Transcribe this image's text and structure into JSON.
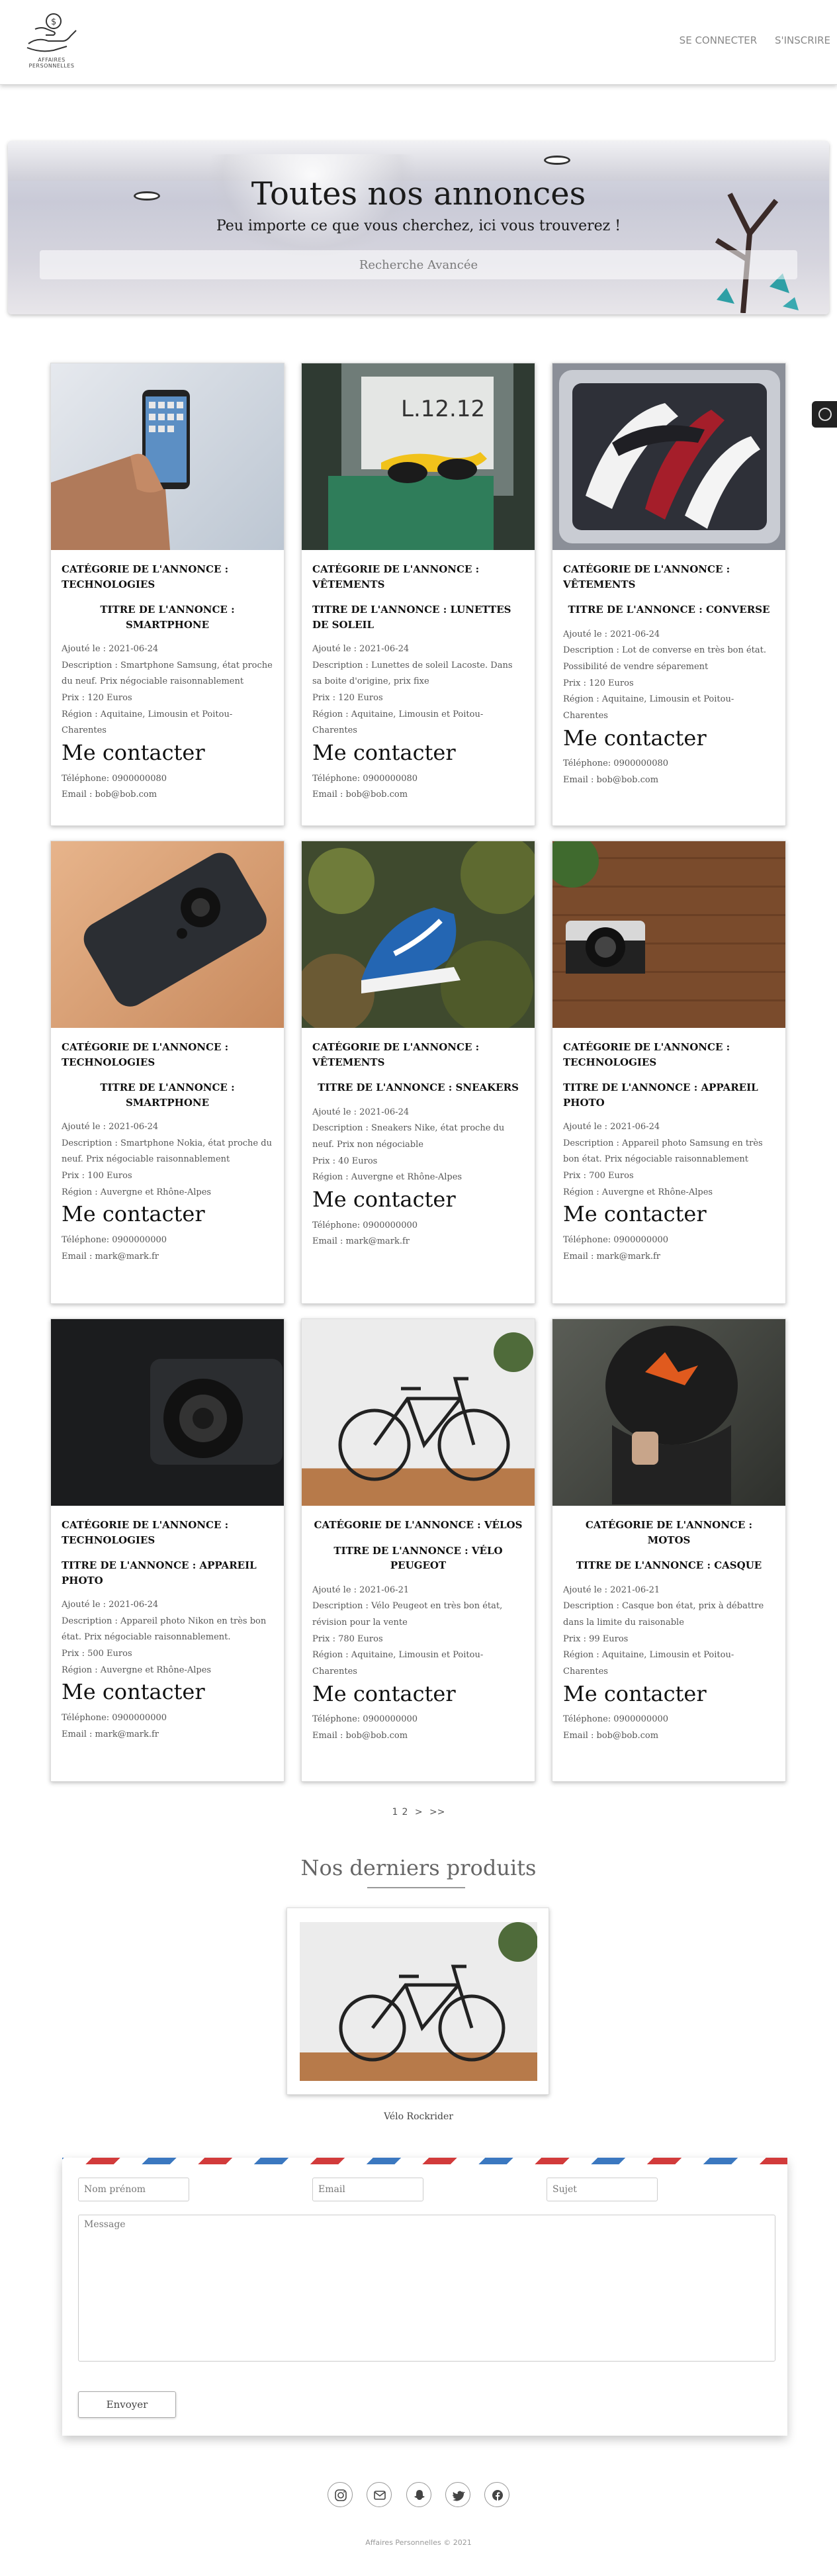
{
  "header": {
    "logo_text": "AFFAIRES PERSONNELLES",
    "nav": [
      {
        "label": "SE CONNECTER"
      },
      {
        "label": "S'INSCRIRE"
      }
    ]
  },
  "hero": {
    "title": "Toutes nos annonces",
    "subtitle": "Peu importe ce que vous cherchez, ici vous trouverez !",
    "search_placeholder": "Recherche Avancée"
  },
  "listings": [
    {
      "category": "CATÉGORIE DE L'ANNONCE : TECHNOLOGIES",
      "title": "TITRE DE L'ANNONCE : SMARTPHONE",
      "added": "Ajouté le : 2021-06-24",
      "description": "Description : Smartphone Samsung, état proche du neuf. Prix négociable raisonnablement",
      "price": "Prix : 120 Euros",
      "region": "Région : Aquitaine, Limousin et Poitou-Charentes",
      "contact": "Me contacter",
      "phone": "Téléphone: 0900000080",
      "email": "Email : bob@bob.com",
      "image": "phone-in-hand"
    },
    {
      "category": "CATÉGORIE DE L'ANNONCE : VÊTEMENTS",
      "title": "TITRE DE L'ANNONCE : LUNETTES DE SOLEIL",
      "added": "Ajouté le : 2021-06-24",
      "description": "Description : Lunettes de soleil Lacoste. Dans sa boite d'origine, prix fixe",
      "price": "Prix : 120 Euros",
      "region": "Région : Aquitaine, Limousin et Poitou-Charentes",
      "contact": "Me contacter",
      "phone": "Téléphone: 0900000080",
      "email": "Email : bob@bob.com",
      "image": "sunglasses"
    },
    {
      "category": "CATÉGORIE DE L'ANNONCE : VÊTEMENTS",
      "title": "TITRE DE L'ANNONCE : CONVERSE",
      "added": "Ajouté le : 2021-06-24",
      "description": "Description : Lot de converse en très bon état. Possibilité de vendre séparement",
      "price": "Prix : 120 Euros",
      "region": "Région : Aquitaine, Limousin et Poitou-Charentes",
      "contact": "Me contacter",
      "phone": "Téléphone: 0900000080",
      "email": "Email : bob@bob.com",
      "image": "sneakers-basket"
    },
    {
      "category": "CATÉGORIE DE L'ANNONCE : TECHNOLOGIES",
      "title": "TITRE DE L'ANNONCE : SMARTPHONE",
      "added": "Ajouté le : 2021-06-24",
      "description": "Description : Smartphone Nokia, état proche du neuf. Prix négociable raisonnablement",
      "price": "Prix : 100 Euros",
      "region": "Région : Auvergne et Rhône-Alpes",
      "contact": "Me contacter",
      "phone": "Téléphone: 0900000000",
      "email": "Email : mark@mark.fr",
      "image": "nokia-phone"
    },
    {
      "category": "CATÉGORIE DE L'ANNONCE : VÊTEMENTS",
      "title": "TITRE DE L'ANNONCE : SNEAKERS",
      "added": "Ajouté le : 2021-06-24",
      "description": "Description : Sneakers Nike, état proche du neuf. Prix non négociable",
      "price": "Prix : 40 Euros",
      "region": "Région : Auvergne et Rhône-Alpes",
      "contact": "Me contacter",
      "phone": "Téléphone: 0900000000",
      "email": "Email : mark@mark.fr",
      "image": "nike-sneaker"
    },
    {
      "category": "CATÉGORIE DE L'ANNONCE : TECHNOLOGIES",
      "title": "TITRE DE L'ANNONCE : APPAREIL PHOTO",
      "added": "Ajouté le : 2021-06-24",
      "description": "Description : Appareil photo Samsung en très bon état. Prix négociable raisonnablement",
      "price": "Prix : 700 Euros",
      "region": "Région : Auvergne et Rhône-Alpes",
      "contact": "Me contacter",
      "phone": "Téléphone: 0900000000",
      "email": "Email : mark@mark.fr",
      "image": "retro-camera"
    },
    {
      "category": "CATÉGORIE DE L'ANNONCE : TECHNOLOGIES",
      "title": "TITRE DE L'ANNONCE : APPAREIL PHOTO",
      "added": "Ajouté le : 2021-06-24",
      "description": "Description : Appareil photo Nikon en très bon état. Prix négociable raisonnablement.",
      "price": "Prix : 500 Euros",
      "region": "Région : Auvergne et Rhône-Alpes",
      "contact": "Me contacter",
      "phone": "Téléphone: 0900000000",
      "email": "Email : mark@mark.fr",
      "image": "dslr-camera"
    },
    {
      "category": "CATÉGORIE DE L'ANNONCE : VÉLOS",
      "title": "TITRE DE L'ANNONCE : VÉLO PEUGEOT",
      "added": "Ajouté le : 2021-06-21",
      "description": "Description : Vélo Peugeot en très bon état, révision pour la vente",
      "price": "Prix : 780 Euros",
      "region": "Région : Aquitaine, Limousin et Poitou-Charentes",
      "contact": "Me contacter",
      "phone": "Téléphone: 0900000000",
      "email": "Email : bob@bob.com",
      "image": "bicycle"
    },
    {
      "category": "CATÉGORIE DE L'ANNONCE : MOTOS",
      "title": "TITRE DE L'ANNONCE : CASQUE",
      "added": "Ajouté le : 2021-06-21",
      "description": "Description : Casque bon état, prix à débattre dans la limite du raisonable",
      "price": "Prix : 99 Euros",
      "region": "Région : Aquitaine, Limousin et Poitou-Charentes",
      "contact": "Me contacter",
      "phone": "Téléphone: 0900000000",
      "email": "Email : bob@bob.com",
      "image": "helmet"
    }
  ],
  "pagination": {
    "p1": "1",
    "p2": "2",
    "next": ">",
    "last": ">>"
  },
  "latest": {
    "heading": "Nos derniers produits",
    "product_label": "Vélo Rockrider"
  },
  "contact_form": {
    "name_placeholder": "Nom prénom",
    "email_placeholder": "Email",
    "subject_placeholder": "Sujet",
    "message_placeholder": "Message",
    "send_label": "Envoyer"
  },
  "socials": [
    "instagram-icon",
    "mail-icon",
    "snapchat-icon",
    "twitter-icon",
    "facebook-icon"
  ],
  "footer": {
    "copyright": "Affaires Personnelles © 2021"
  }
}
